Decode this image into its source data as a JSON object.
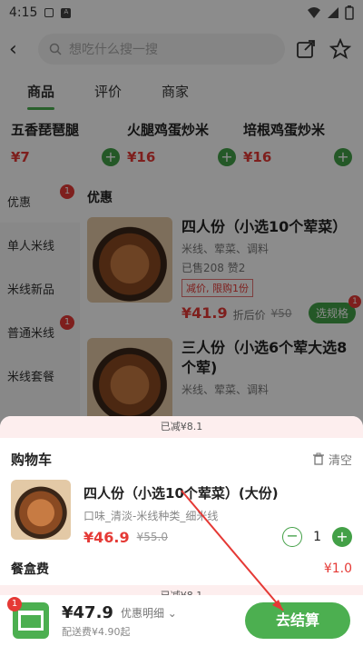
{
  "status": {
    "time": "4:15"
  },
  "search": {
    "placeholder": "想吃什么搜一搜"
  },
  "tabs": [
    "商品",
    "评价",
    "商家"
  ],
  "combos": [
    {
      "name": "五香琵琶腿",
      "price": "¥7"
    },
    {
      "name": "火腿鸡蛋炒米",
      "price": "¥16"
    },
    {
      "name": "培根鸡蛋炒米",
      "price": "¥16"
    }
  ],
  "sidebar": [
    {
      "label": "优惠",
      "badge": "1"
    },
    {
      "label": "单人米线",
      "badge": ""
    },
    {
      "label": "米线新品",
      "badge": ""
    },
    {
      "label": "普通米线",
      "badge": "1"
    },
    {
      "label": "米线套餐",
      "badge": ""
    }
  ],
  "main": {
    "section_title": "优惠",
    "products": [
      {
        "title": "四人份（小选10个荤菜）",
        "sub": "米线、荤菜、调料",
        "sales": "已售208 赞2",
        "tag": "减价, 限购1份",
        "price": "¥41.9",
        "price_note": "折后价",
        "old": "¥50",
        "spec": "选规格",
        "spec_badge": "1"
      },
      {
        "title": "三人份（小选6个荤大选8个荤)",
        "sub": "米线、荤菜、调料"
      }
    ]
  },
  "cart": {
    "discount": "已减¥8.1",
    "title": "购物车",
    "clear": "清空",
    "item": {
      "title": "四人份（小选10个荤菜）(大份)",
      "desc": "口味_清淡-米线种类_细米线",
      "price": "¥46.9",
      "old": "¥55.0",
      "qty": "1"
    },
    "box_fee_label": "餐盒费",
    "box_fee": "¥1.0",
    "discount2": "已减¥8.1"
  },
  "bottom": {
    "badge": "1",
    "amount": "¥47.9",
    "detail": "优惠明细",
    "fee": "配送费¥4.90起",
    "checkout": "去结算"
  },
  "colors": {
    "accent": "#4caf50",
    "price": "#e53935"
  }
}
